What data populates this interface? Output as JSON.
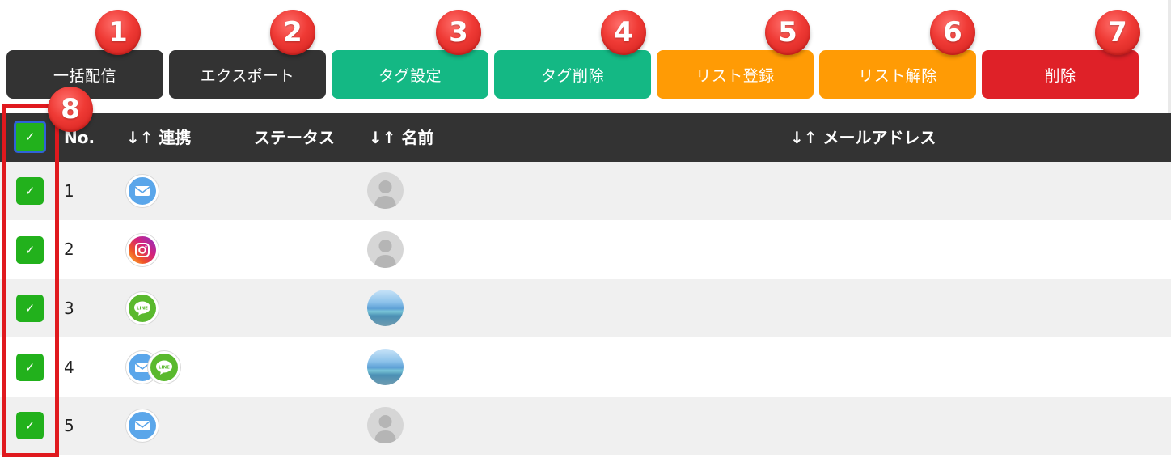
{
  "toolbar": {
    "buttons": [
      {
        "label": "一括配信",
        "color": "#333333"
      },
      {
        "label": "エクスポート",
        "color": "#333333"
      },
      {
        "label": "タグ設定",
        "color": "#14b884"
      },
      {
        "label": "タグ削除",
        "color": "#14b884"
      },
      {
        "label": "リスト登録",
        "color": "#ff9b05"
      },
      {
        "label": "リスト解除",
        "color": "#ff9b05"
      },
      {
        "label": "削除",
        "color": "#df2128"
      }
    ]
  },
  "callouts": [
    "1",
    "2",
    "3",
    "4",
    "5",
    "6",
    "7",
    "8"
  ],
  "table": {
    "headers": {
      "no": "No.",
      "linked": "↓↑ 連携",
      "status": "ステータス",
      "name": "↓↑ 名前",
      "email": "↓↑ メールアドレス"
    },
    "rows": [
      {
        "no": "1",
        "channels": [
          "mail-icon"
        ],
        "avatar": "default-avatar",
        "checked": true
      },
      {
        "no": "2",
        "channels": [
          "instagram-icon"
        ],
        "avatar": "default-avatar",
        "checked": true
      },
      {
        "no": "3",
        "channels": [
          "line-icon"
        ],
        "avatar": "sky-photo-avatar",
        "checked": true
      },
      {
        "no": "4",
        "channels": [
          "mail-icon",
          "line-icon"
        ],
        "avatar": "sky-photo-avatar",
        "checked": true
      },
      {
        "no": "5",
        "channels": [
          "mail-icon"
        ],
        "avatar": "default-avatar",
        "checked": true
      }
    ]
  },
  "icons": {
    "checkmark": "✓",
    "line_text": "LINE"
  },
  "colors": {
    "checkbox": "#22b11c",
    "highlight_frame": "#e0191e",
    "header_bg": "#333333",
    "callout": "#ef3a35"
  }
}
